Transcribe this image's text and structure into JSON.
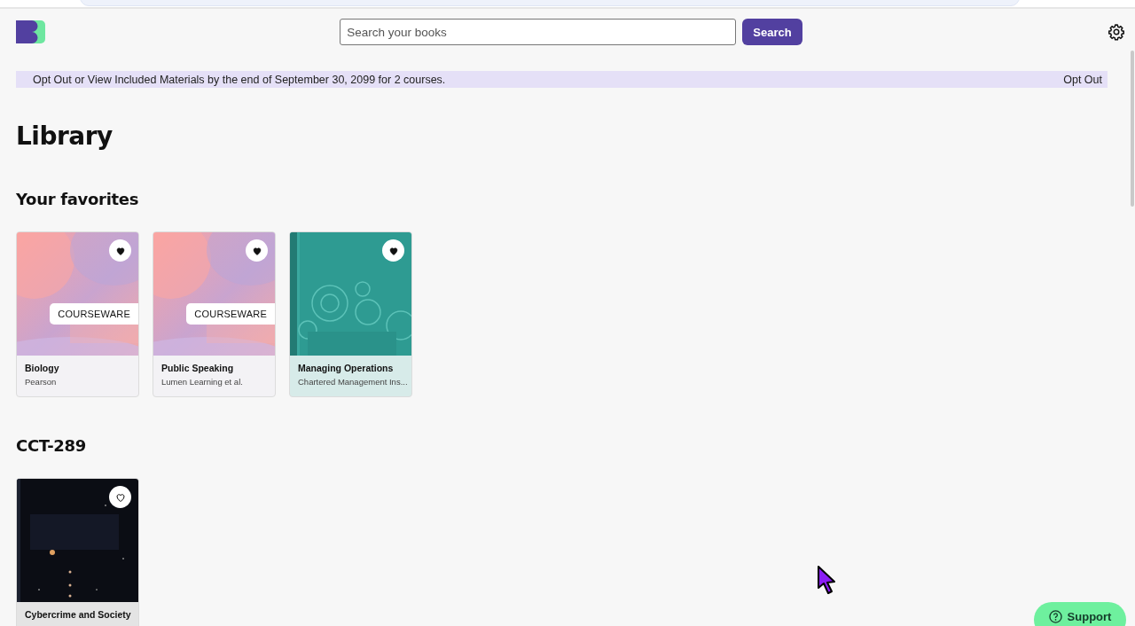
{
  "search": {
    "placeholder": "Search your books",
    "button": "Search"
  },
  "banner": {
    "message": "Opt Out or View Included Materials by the end of September 30, 2099 for 2 courses.",
    "action": "Opt Out"
  },
  "page_title": "Library",
  "sections": [
    {
      "title": "Your favorites",
      "books": [
        {
          "title": "Biology",
          "author": "Pearson",
          "cover": {
            "kind": "courseware",
            "label": "COURSEWARE"
          },
          "favorite": true
        },
        {
          "title": "Public Speaking",
          "author": "Lumen Learning et al.",
          "cover": {
            "kind": "courseware",
            "label": "COURSEWARE"
          },
          "favorite": true
        },
        {
          "title": "Managing Operations",
          "author": "Chartered Management Ins...",
          "cover": {
            "kind": "gears"
          },
          "favorite": true
        }
      ]
    },
    {
      "title": "CCT-289",
      "books": [
        {
          "title": "Cybercrime and Society",
          "cover": {
            "kind": "space"
          },
          "favorite": false
        }
      ]
    }
  ],
  "support": {
    "label": "Support"
  }
}
